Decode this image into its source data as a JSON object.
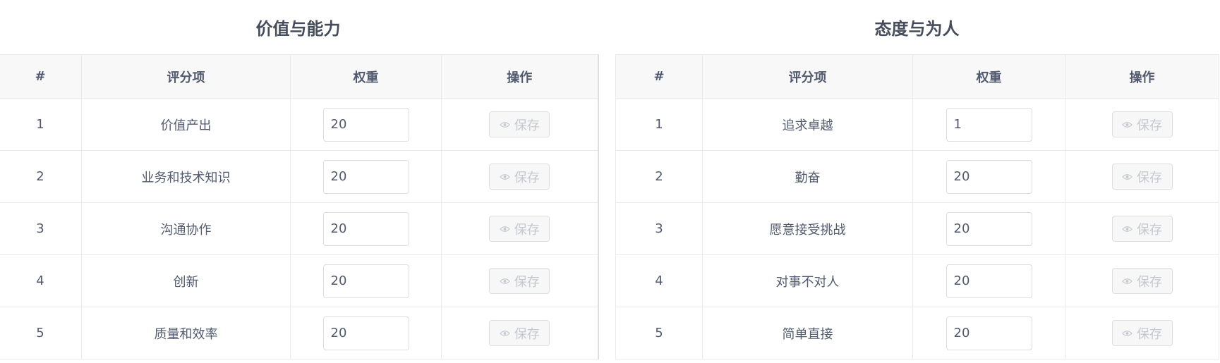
{
  "left_panel": {
    "title": "价值与能力",
    "columns": [
      "#",
      "评分项",
      "权重",
      "操作"
    ],
    "rows": [
      {
        "index": "1",
        "item": "价值产出",
        "weight": "20",
        "action": "保存"
      },
      {
        "index": "2",
        "item": "业务和技术知识",
        "weight": "20",
        "action": "保存"
      },
      {
        "index": "3",
        "item": "沟通协作",
        "weight": "20",
        "action": "保存"
      },
      {
        "index": "4",
        "item": "创新",
        "weight": "20",
        "action": "保存"
      },
      {
        "index": "5",
        "item": "质量和效率",
        "weight": "20",
        "action": "保存"
      }
    ]
  },
  "right_panel": {
    "title": "态度与为人",
    "columns": [
      "#",
      "评分项",
      "权重",
      "操作"
    ],
    "rows": [
      {
        "index": "1",
        "item": "追求卓越",
        "weight": "1",
        "action": "保存"
      },
      {
        "index": "2",
        "item": "勤奋",
        "weight": "20",
        "action": "保存"
      },
      {
        "index": "3",
        "item": "愿意接受挑战",
        "weight": "20",
        "action": "保存"
      },
      {
        "index": "4",
        "item": "对事不对人",
        "weight": "20",
        "action": "保存"
      },
      {
        "index": "5",
        "item": "简单直接",
        "weight": "20",
        "action": "保存"
      }
    ]
  },
  "icons": {
    "save_button_icon": "eye-icon"
  },
  "colors": {
    "header_bg": "#f8f8f9",
    "border": "#e8eaec",
    "text": "#515a6e",
    "disabled_text": "#c5c8ce"
  }
}
